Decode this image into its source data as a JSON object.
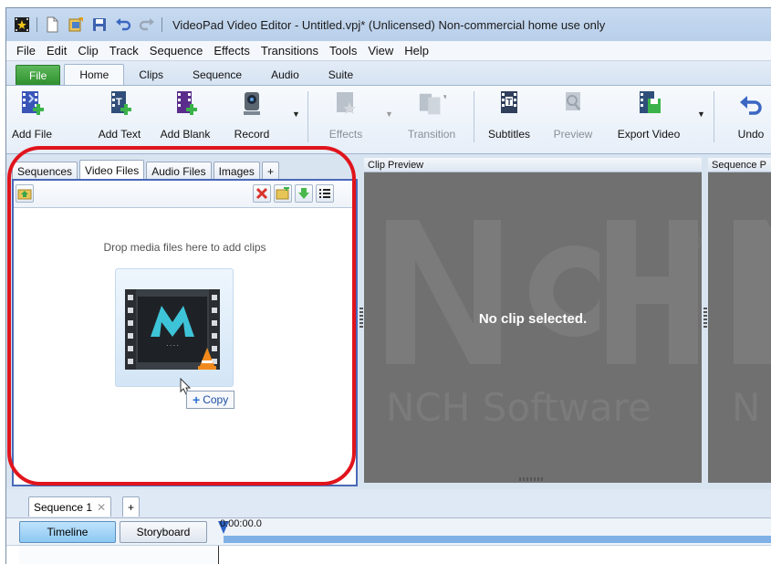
{
  "window": {
    "title": "VideoPad Video Editor - Untitled.vpj* (Unlicensed) Non-commercial home use only"
  },
  "menu": [
    "File",
    "Edit",
    "Clip",
    "Track",
    "Sequence",
    "Effects",
    "Transitions",
    "Tools",
    "View",
    "Help"
  ],
  "ribbon_tabs": [
    "File",
    "Home",
    "Clips",
    "Sequence",
    "Audio",
    "Suite"
  ],
  "ribbon_active_tab": "Home",
  "toolbar": {
    "add_file": "Add File",
    "add_text": "Add Text",
    "add_blank": "Add Blank",
    "record": "Record",
    "effects": "Effects",
    "transition": "Transition",
    "subtitles": "Subtitles",
    "preview": "Preview",
    "export_video": "Export Video",
    "undo": "Undo"
  },
  "bin": {
    "tabs": [
      "Sequences",
      "Video Files",
      "Audio Files",
      "Images",
      "+"
    ],
    "active_tab": "Video Files",
    "drop_hint": "Drop media files here to add clips",
    "drag_tooltip": "Copy"
  },
  "clip_preview": {
    "header": "Clip Preview",
    "message": "No clip selected.",
    "watermark": "NCH Software"
  },
  "sequence_preview": {
    "header": "Sequence P"
  },
  "sequence": {
    "tab_label": "Sequence 1",
    "add_tab": "+",
    "timeline_button": "Timeline",
    "storyboard_button": "Storyboard",
    "timecode": "0:00:00.0"
  },
  "colors": {
    "highlight_red": "#e0141c",
    "file_tab_green": "#3a9a39",
    "preview_gray": "#707070",
    "panel_border_blue": "#4a68b8"
  }
}
